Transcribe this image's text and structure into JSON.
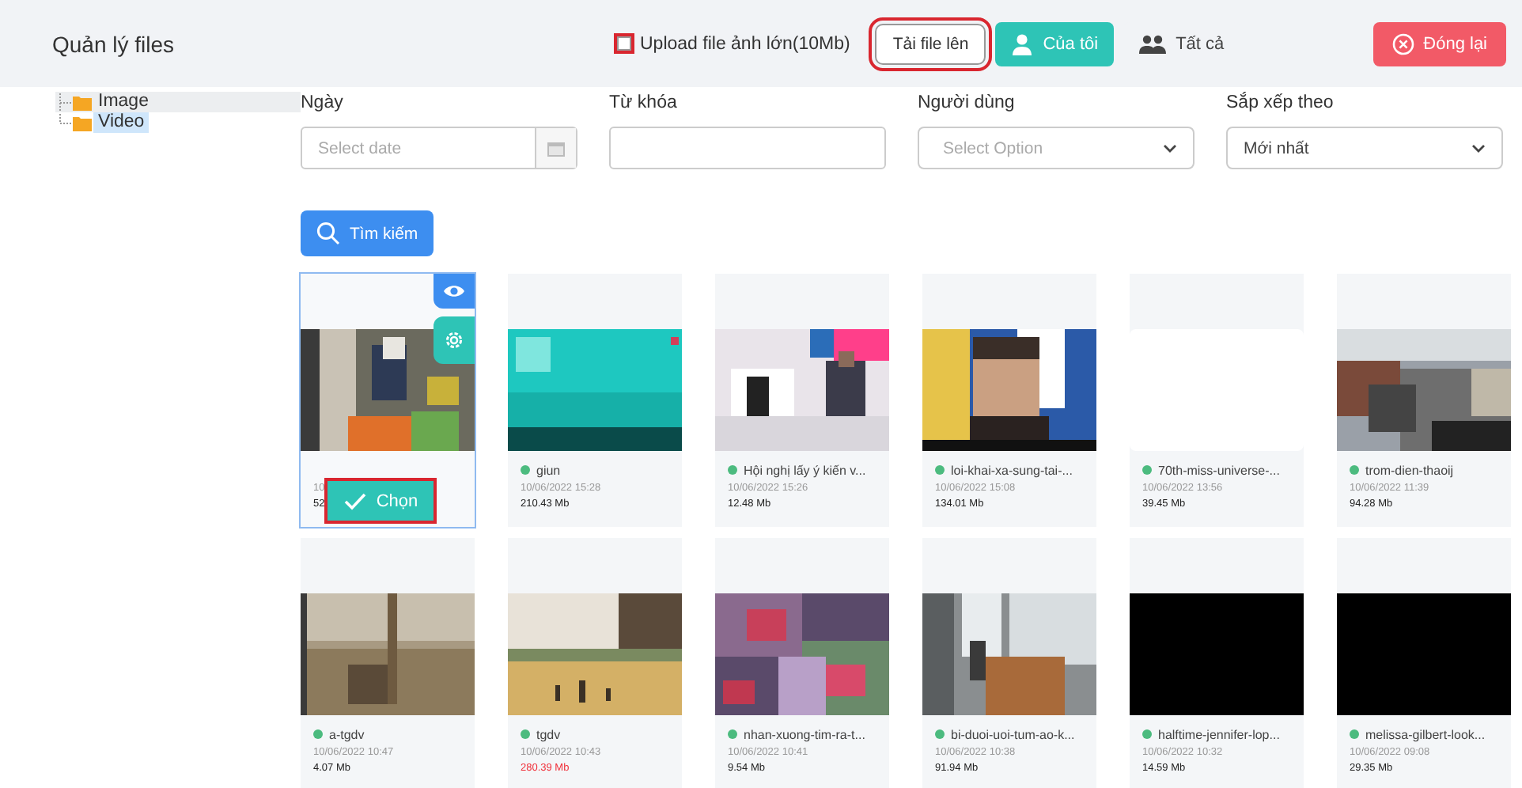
{
  "header": {
    "title": "Quản lý files",
    "upload_large": {
      "label": "Upload file ảnh lớn(10Mb)",
      "checked": false,
      "highlighted": true
    },
    "buttons": [
      {
        "kind": "upload",
        "label": "Tải file lên",
        "highlighted": true
      },
      {
        "kind": "mine",
        "label": "Của tôi",
        "selected": true,
        "highlighted": false
      },
      {
        "kind": "all",
        "label": "Tất cả",
        "selected": false,
        "highlighted": false
      },
      {
        "kind": "close",
        "label": "Đóng lại",
        "highlighted": false
      }
    ]
  },
  "tree": [
    {
      "label": "Image",
      "selected": false
    },
    {
      "label": "Video",
      "selected": true
    }
  ],
  "filters": [
    {
      "kind": "date",
      "label": "Ngày",
      "placeholder": "Select date"
    },
    {
      "kind": "text",
      "label": "Từ khóa"
    },
    {
      "kind": "select",
      "label": "Người dùng",
      "placeholder": "Select Option"
    },
    {
      "kind": "select",
      "label": "Sắp xếp theo",
      "value": "Mới nhất"
    }
  ],
  "search_button": "Tìm kiếm",
  "files": [
    {
      "kind": "picture",
      "date": "10",
      "size": "52",
      "selected": true,
      "choose_label": "Chọn",
      "choose_highlighted": true,
      "oversize": false
    },
    {
      "kind": "picture",
      "name": "giun",
      "date": "10/06/2022 15:28",
      "size": "210.43 Mb",
      "selected": false,
      "oversize": false
    },
    {
      "kind": "picture",
      "name": "Hội nghị lấy ý kiến v...",
      "date": "10/06/2022 15:26",
      "size": "12.48 Mb",
      "selected": false,
      "oversize": false
    },
    {
      "kind": "picture",
      "name": "loi-khai-xa-sung-tai-...",
      "date": "10/06/2022 15:08",
      "size": "134.01 Mb",
      "selected": false,
      "oversize": false
    },
    {
      "kind": "blank",
      "name": "70th-miss-universe-...",
      "date": "10/06/2022 13:56",
      "size": "39.45 Mb",
      "selected": false,
      "oversize": false
    },
    {
      "kind": "picture",
      "name": "trom-dien-thaoij",
      "date": "10/06/2022 11:39",
      "size": "94.28 Mb",
      "selected": false,
      "oversize": false
    },
    {
      "kind": "picture",
      "name": "a-tgdv",
      "date": "10/06/2022 10:47",
      "size": "4.07 Mb",
      "selected": false,
      "oversize": false
    },
    {
      "kind": "picture",
      "name": "tgdv",
      "date": "10/06/2022 10:43",
      "size": "280.39 Mb",
      "selected": false,
      "oversize": true
    },
    {
      "kind": "picture",
      "name": "nhan-xuong-tim-ra-t...",
      "date": "10/06/2022 10:41",
      "size": "9.54 Mb",
      "selected": false,
      "oversize": false
    },
    {
      "kind": "picture",
      "name": "bi-duoi-uoi-tum-ao-k...",
      "date": "10/06/2022 10:38",
      "size": "91.94 Mb",
      "selected": false,
      "oversize": false
    },
    {
      "kind": "dark",
      "name": "halftime-jennifer-lop...",
      "date": "10/06/2022 10:32",
      "size": "14.59 Mb",
      "selected": false,
      "oversize": false
    },
    {
      "kind": "dark",
      "name": "melissa-gilbert-look...",
      "date": "10/06/2022 09:08",
      "size": "29.35 Mb",
      "selected": false,
      "oversize": false
    }
  ]
}
